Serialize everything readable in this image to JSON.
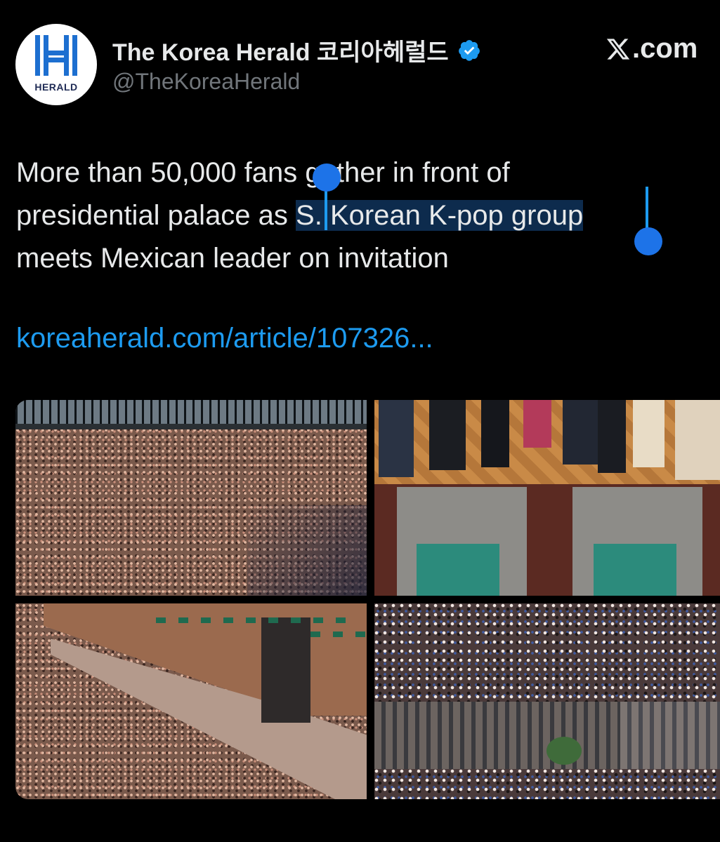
{
  "account": {
    "display_name": "The Korea Herald 코리아헤럴드",
    "handle": "@TheKoreaHerald",
    "avatar_text": "HERALD",
    "verified": true
  },
  "site_mark": ".com",
  "tweet": {
    "line1": "More than 50,000 fans gather in front of",
    "line2_pre": "presidential palace as ",
    "line2_selected": "S. Korean K-pop group",
    "line3": "meets Mexican leader on invitation",
    "link": "koreaherald.com/article/107326..."
  },
  "media": {
    "images": [
      {
        "description": "crowd in plaza behind railing"
      },
      {
        "description": "legs of people standing on wooden floor above windows"
      },
      {
        "description": "crowd beside palace facade with guards"
      },
      {
        "description": "fans cheering in square with buildings"
      }
    ]
  },
  "colors": {
    "background": "#000000",
    "text": "#e7e9ea",
    "secondary_text": "#71767b",
    "link": "#1d9bf0",
    "selection": "#0d2b4d",
    "verified_badge": "#1d9bf0"
  }
}
